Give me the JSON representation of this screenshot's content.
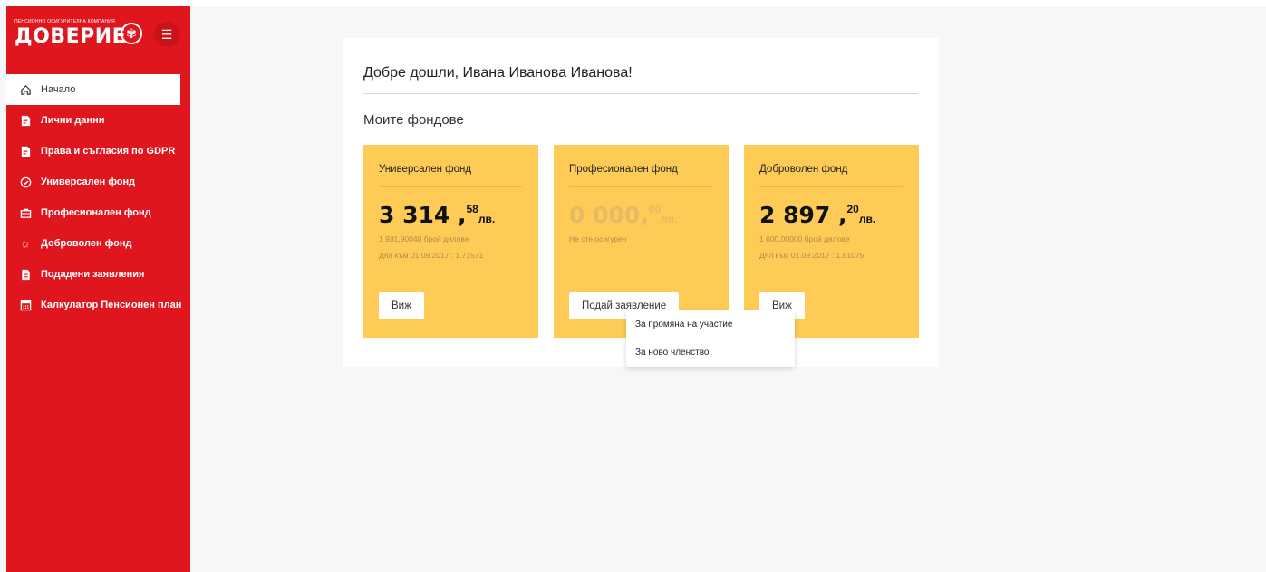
{
  "brand": {
    "tagline": "ПЕНСИОННО ОСИГУРИТЕЛНА КОМПАНИЯ",
    "name": "ДОВЕРИЕ"
  },
  "sidebar": {
    "items": [
      {
        "label": "Начало",
        "icon": "home-icon",
        "active": true
      },
      {
        "label": "Лични данни",
        "icon": "personal-data-icon"
      },
      {
        "label": "Права и съгласия по GDPR",
        "icon": "gdpr-icon"
      },
      {
        "label": "Универсален фонд",
        "icon": "check-circle-icon"
      },
      {
        "label": "Професионален фонд",
        "icon": "briefcase-icon"
      },
      {
        "label": "Доброволен фонд",
        "icon": "sun-icon"
      },
      {
        "label": "Подадени заявления",
        "icon": "document-icon"
      },
      {
        "label": "Калкулатор Пенсионен план",
        "icon": "calculator-icon"
      }
    ]
  },
  "main": {
    "welcome": "Добре дошли, Ивана Иванова Иванова!",
    "funds_title": "Моите фондове",
    "funds": [
      {
        "title": "Универсален фонд",
        "amount_main": "3 314 ,",
        "amount_cents": "58",
        "currency": "лв.",
        "units": "1 931,90048 брой дялове",
        "unit_value": "Дял към 01.09.2017 : 1.71571",
        "button": "Виж"
      },
      {
        "title": "Професионален фонд",
        "amount_main": "0 000,",
        "amount_cents": "00",
        "currency": "лв.",
        "status": "Не сте осигурен",
        "button": "Подай заявление"
      },
      {
        "title": "Доброволен фонд",
        "amount_main": "2 897 ,",
        "amount_cents": "20",
        "currency": "лв.",
        "units": "1 600,00000 брой дялове",
        "unit_value": "Дял към 01.09.2017 : 1.81075",
        "button": "Виж"
      }
    ],
    "dropdown": {
      "items": [
        "За промяна на участие",
        "За ново членство"
      ]
    }
  },
  "colors": {
    "sidebar": "#e0161f",
    "fund_card": "#fecb57",
    "background": "#f6f7f9"
  }
}
